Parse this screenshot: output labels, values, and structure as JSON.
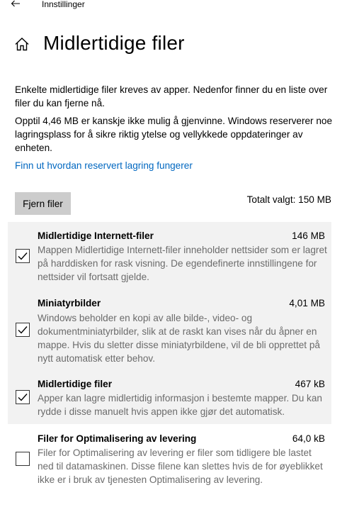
{
  "window": {
    "title": "Innstillinger"
  },
  "page": {
    "title": "Midlertidige filer",
    "intro": "Enkelte midlertidige filer kreves av apper. Nedenfor finner du en liste over filer du kan fjerne nå.",
    "reserved_info": "Opptil 4,46 MB er kanskje ikke mulig å gjenvinne. Windows reserverer noe lagringsplass for å sikre riktig ytelse og vellykkede oppdateringer av enheten.",
    "link_label": "Finn ut hvordan reservert lagring fungerer",
    "remove_button_label": "Fjern filer",
    "total_selected": "Totalt valgt: 150 MB"
  },
  "items": [
    {
      "name": "Midlertidige Internett-filer",
      "size": "146 MB",
      "description": "Mappen Midlertidige Internett-filer inneholder nettsider som er lagret på harddisken for rask visning. De egendefinerte innstillingene for nettsider vil fortsatt gjelde.",
      "checked": true
    },
    {
      "name": "Miniatyrbilder",
      "size": "4,01 MB",
      "description": "Windows beholder en kopi av alle bilde-, video- og dokumentminiatyrbilder, slik at de raskt kan vises når du åpner en mappe. Hvis du sletter disse miniatyrbildene, vil de bli opprettet på nytt automatisk etter behov.",
      "checked": true
    },
    {
      "name": "Midlertidige filer",
      "size": "467 kB",
      "description": "Apper kan lagre midlertidig informasjon i bestemte mapper. Du kan rydde i disse manuelt hvis appen ikke gjør det automatisk.",
      "checked": true
    },
    {
      "name": "Filer for Optimalisering av levering",
      "size": "64,0 kB",
      "description": "Filer for Optimalisering av levering er filer som tidligere ble lastet ned til datamaskinen. Disse filene kan slettes hvis de for øyeblikket ikke er i bruk av tjenesten Optimalisering av levering.",
      "checked": false
    }
  ],
  "icons": {
    "back": "back-arrow-icon",
    "home": "home-icon",
    "check": "checkmark-icon"
  },
  "colors": {
    "accent": "#0067c0",
    "selected_background": "#f2f2f2",
    "button_background": "#cccccc",
    "description_text": "#6b6b6b"
  }
}
